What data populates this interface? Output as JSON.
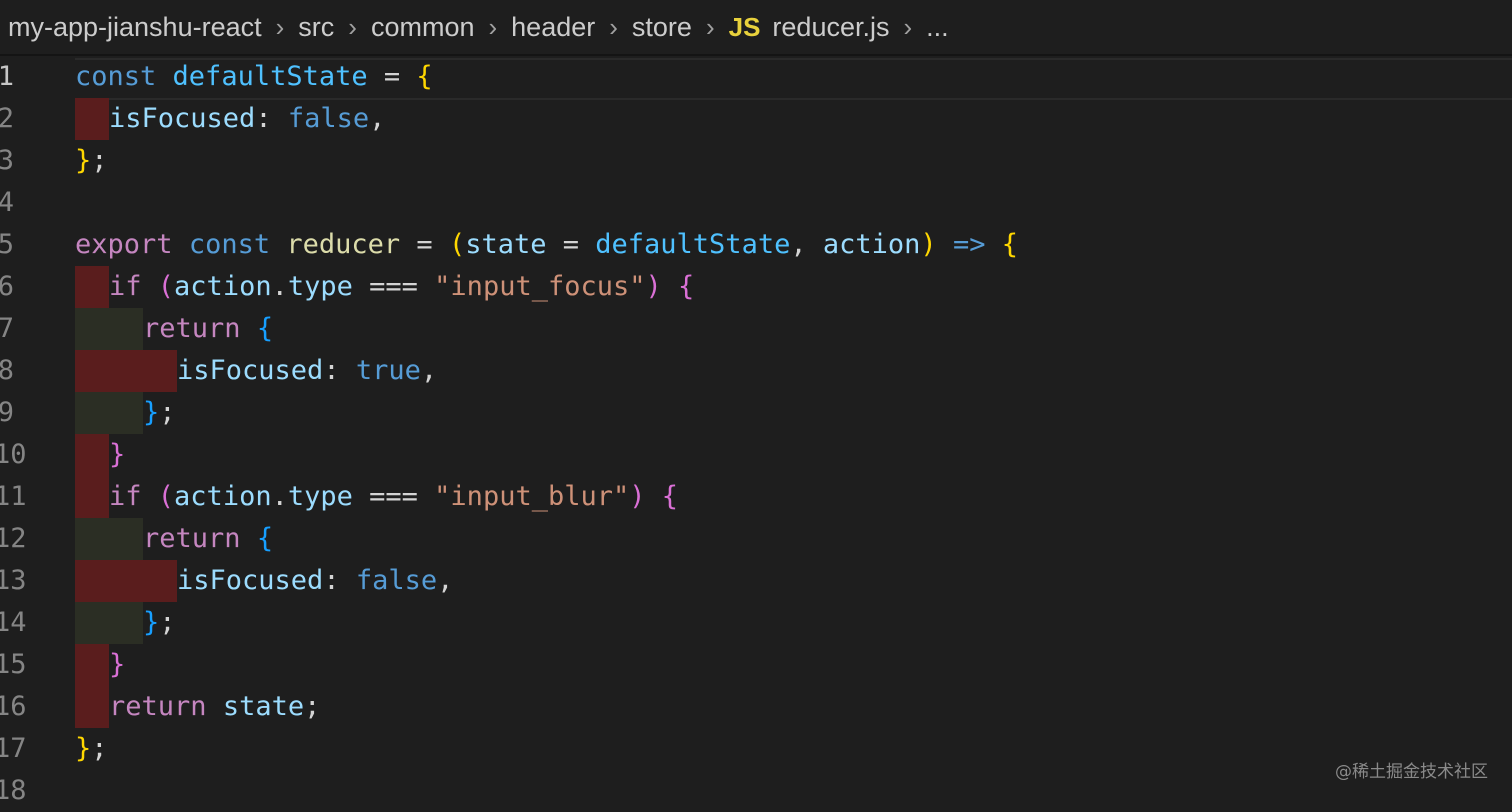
{
  "breadcrumb": {
    "segments": [
      "my-app-jianshu-react",
      "src",
      "common",
      "header",
      "store"
    ],
    "file_icon": "JS",
    "file_name": "reducer.js",
    "overflow": "...",
    "separator_icon": "chevron-right-icon"
  },
  "editor": {
    "colors": {
      "background": "#1e1e1e",
      "indent_error": "#5a1d1d",
      "indent_odd": "#2b2e24",
      "keyword": "#569cd6",
      "control": "#c586c0",
      "string": "#ce9178",
      "property": "#9cdcfe",
      "bracket_level1": "#ffd700",
      "bracket_level2": "#da70d6",
      "bracket_level3": "#179fff"
    },
    "line_numbers": [
      "1",
      "2",
      "3",
      "4",
      "5",
      "6",
      "7",
      "8",
      "9",
      "10",
      "11",
      "12",
      "13",
      "14",
      "15",
      "16",
      "17",
      "18"
    ],
    "lines": [
      {
        "ind": [],
        "toks": [
          [
            "kw",
            "const"
          ],
          [
            "op",
            " "
          ],
          [
            "var",
            "defaultState"
          ],
          [
            "op",
            " = "
          ],
          [
            "b1",
            "{"
          ]
        ]
      },
      {
        "ind": [
          "red"
        ],
        "toks": [
          [
            "prop",
            "isFocused"
          ],
          [
            "op",
            ": "
          ],
          [
            "kw",
            "false"
          ],
          [
            "op",
            ","
          ]
        ]
      },
      {
        "ind": [],
        "toks": [
          [
            "b1",
            "}"
          ],
          [
            "op",
            ";"
          ]
        ]
      },
      {
        "ind": [],
        "toks": []
      },
      {
        "ind": [],
        "toks": [
          [
            "ctl",
            "export"
          ],
          [
            "op",
            " "
          ],
          [
            "kw",
            "const"
          ],
          [
            "op",
            " "
          ],
          [
            "fn",
            "reducer"
          ],
          [
            "op",
            " = "
          ],
          [
            "b1",
            "("
          ],
          [
            "prop",
            "state"
          ],
          [
            "op",
            " = "
          ],
          [
            "var",
            "defaultState"
          ],
          [
            "op",
            ", "
          ],
          [
            "prop",
            "action"
          ],
          [
            "b1",
            ")"
          ],
          [
            "op",
            " "
          ],
          [
            "kw",
            "=>"
          ],
          [
            "op",
            " "
          ],
          [
            "b1",
            "{"
          ]
        ]
      },
      {
        "ind": [
          "red"
        ],
        "toks": [
          [
            "ctl",
            "if"
          ],
          [
            "op",
            " "
          ],
          [
            "b2",
            "("
          ],
          [
            "prop",
            "action"
          ],
          [
            "op",
            "."
          ],
          [
            "prop",
            "type"
          ],
          [
            "op",
            " === "
          ],
          [
            "str",
            "\"input_focus\""
          ],
          [
            "b2",
            ")"
          ],
          [
            "op",
            " "
          ],
          [
            "b2",
            "{"
          ]
        ]
      },
      {
        "ind": [
          "dark",
          "dark"
        ],
        "toks": [
          [
            "ctl",
            "return"
          ],
          [
            "op",
            " "
          ],
          [
            "b3",
            "{"
          ]
        ]
      },
      {
        "ind": [
          "red",
          "red",
          "red"
        ],
        "toks": [
          [
            "prop",
            "isFocused"
          ],
          [
            "op",
            ": "
          ],
          [
            "kw",
            "true"
          ],
          [
            "op",
            ","
          ]
        ]
      },
      {
        "ind": [
          "dark",
          "dark"
        ],
        "toks": [
          [
            "b3",
            "}"
          ],
          [
            "op",
            ";"
          ]
        ]
      },
      {
        "ind": [
          "red"
        ],
        "toks": [
          [
            "b2",
            "}"
          ]
        ]
      },
      {
        "ind": [
          "red"
        ],
        "toks": [
          [
            "ctl",
            "if"
          ],
          [
            "op",
            " "
          ],
          [
            "b2",
            "("
          ],
          [
            "prop",
            "action"
          ],
          [
            "op",
            "."
          ],
          [
            "prop",
            "type"
          ],
          [
            "op",
            " === "
          ],
          [
            "str",
            "\"input_blur\""
          ],
          [
            "b2",
            ")"
          ],
          [
            "op",
            " "
          ],
          [
            "b2",
            "{"
          ]
        ]
      },
      {
        "ind": [
          "dark",
          "dark"
        ],
        "toks": [
          [
            "ctl",
            "return"
          ],
          [
            "op",
            " "
          ],
          [
            "b3",
            "{"
          ]
        ]
      },
      {
        "ind": [
          "red",
          "red",
          "red"
        ],
        "toks": [
          [
            "prop",
            "isFocused"
          ],
          [
            "op",
            ": "
          ],
          [
            "kw",
            "false"
          ],
          [
            "op",
            ","
          ]
        ]
      },
      {
        "ind": [
          "dark",
          "dark"
        ],
        "toks": [
          [
            "b3",
            "}"
          ],
          [
            "op",
            ";"
          ]
        ]
      },
      {
        "ind": [
          "red"
        ],
        "toks": [
          [
            "b2",
            "}"
          ]
        ]
      },
      {
        "ind": [
          "red"
        ],
        "toks": [
          [
            "ctl",
            "return"
          ],
          [
            "op",
            " "
          ],
          [
            "prop",
            "state"
          ],
          [
            "op",
            ";"
          ]
        ]
      },
      {
        "ind": [],
        "toks": [
          [
            "b1",
            "}"
          ],
          [
            "op",
            ";"
          ]
        ]
      },
      {
        "ind": [],
        "toks": []
      }
    ]
  },
  "watermark": "@稀土掘金技术社区"
}
